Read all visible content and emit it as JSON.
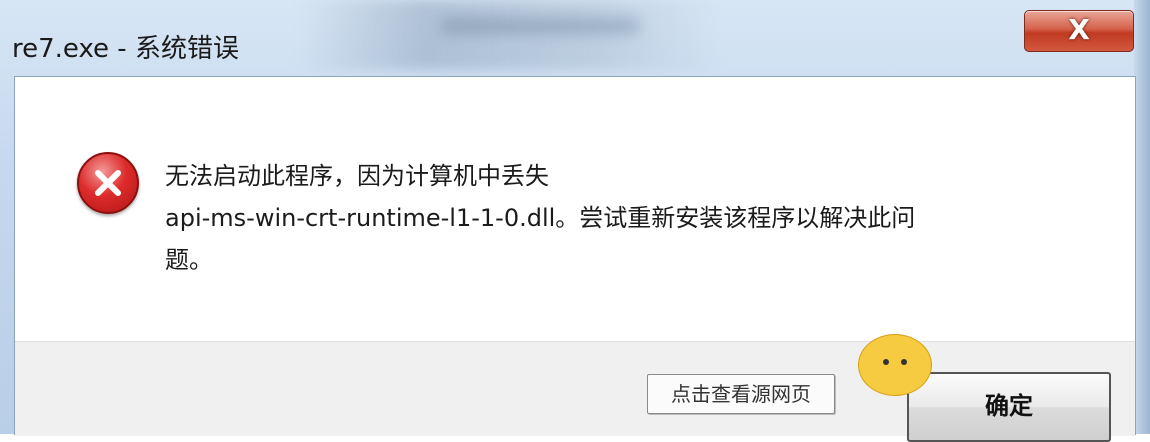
{
  "window": {
    "title": "re7.exe - 系统错误",
    "close_symbol": "X"
  },
  "dialog": {
    "icon": "error-icon",
    "message_lines": [
      "无法启动此程序，因为计算机中丢失",
      "api-ms-win-crt-runtime-l1-1-0.dll。尝试重新安装该程序以解决此问",
      "题。"
    ],
    "ok_label": "确定"
  },
  "overlay": {
    "view_source_label": "点击查看源网页",
    "mascot_icon": "chick-icon"
  },
  "colors": {
    "close_button": "#c13a22",
    "error_icon": "#dd2b2b",
    "frame": "#c4d8ee"
  }
}
